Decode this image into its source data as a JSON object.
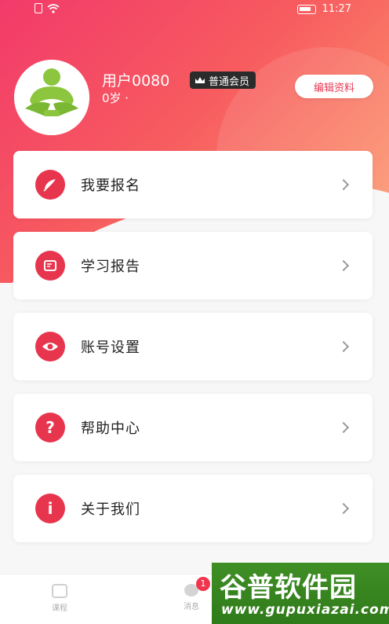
{
  "status_bar": {
    "time": "11:27"
  },
  "profile": {
    "username": "用户0080",
    "member_badge": "普通会员",
    "age": "0岁 ·",
    "edit_button": "编辑资料"
  },
  "menu": [
    {
      "label": "我要报名",
      "icon": "pen-icon"
    },
    {
      "label": "学习报告",
      "icon": "report-icon"
    },
    {
      "label": "账号设置",
      "icon": "eye-icon"
    },
    {
      "label": "帮助中心",
      "icon": "question-icon"
    },
    {
      "label": "关于我们",
      "icon": "info-icon"
    }
  ],
  "tabbar": {
    "tabs": [
      {
        "label": "课程"
      },
      {
        "label": "消息"
      }
    ],
    "message_badge": "1"
  },
  "watermark": {
    "title": "谷普软件园",
    "url": "www.gupuxiazai.com"
  },
  "colors": {
    "accent": "#e8354e",
    "hero_start": "#f23a6a",
    "hero_end": "#f9a27a"
  }
}
